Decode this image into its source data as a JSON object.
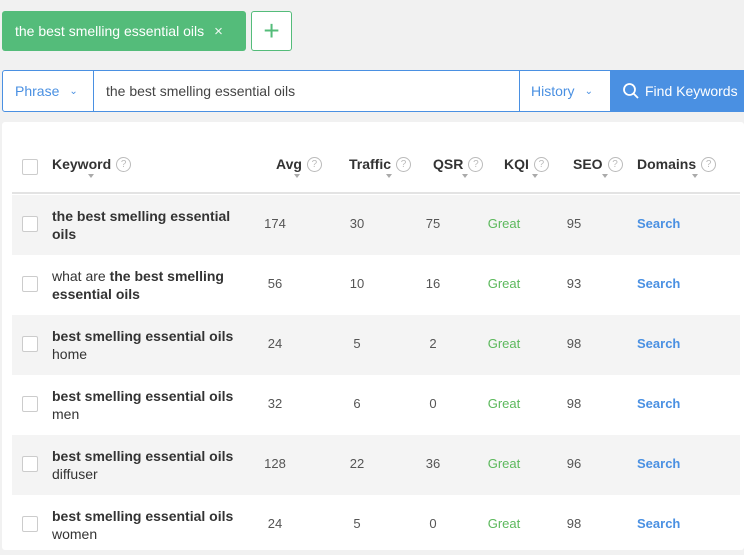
{
  "tag": {
    "label": "the best smelling essential oils",
    "close": "×",
    "add": "+"
  },
  "search": {
    "mode": "Phrase",
    "query": "the best smelling essential oils",
    "history": "History",
    "find": "Find Keywords"
  },
  "table": {
    "columns": [
      "Keyword",
      "Avg",
      "Traffic",
      "QSR",
      "KQI",
      "SEO",
      "Domains"
    ],
    "rows": [
      {
        "pre": "",
        "bold": "the best smelling essential oils",
        "post": "",
        "avg": "174",
        "traffic": "30",
        "qsr": "75",
        "kqi": "Great",
        "seo": "95",
        "domains": "Search"
      },
      {
        "pre": "what are ",
        "bold": "the best smelling essential oils",
        "post": "",
        "avg": "56",
        "traffic": "10",
        "qsr": "16",
        "kqi": "Great",
        "seo": "93",
        "domains": "Search"
      },
      {
        "pre": "",
        "bold": "best smelling essential oils",
        "post": "home",
        "avg": "24",
        "traffic": "5",
        "qsr": "2",
        "kqi": "Great",
        "seo": "98",
        "domains": "Search"
      },
      {
        "pre": "",
        "bold": "best smelling essential oils",
        "post": "men",
        "avg": "32",
        "traffic": "6",
        "qsr": "0",
        "kqi": "Great",
        "seo": "98",
        "domains": "Search"
      },
      {
        "pre": "",
        "bold": "best smelling essential oils",
        "post": "diffuser",
        "avg": "128",
        "traffic": "22",
        "qsr": "36",
        "kqi": "Great",
        "seo": "96",
        "domains": "Search"
      },
      {
        "pre": "",
        "bold": "best smelling essential oils",
        "post": "women",
        "avg": "24",
        "traffic": "5",
        "qsr": "0",
        "kqi": "Great",
        "seo": "98",
        "domains": "Search"
      }
    ]
  }
}
